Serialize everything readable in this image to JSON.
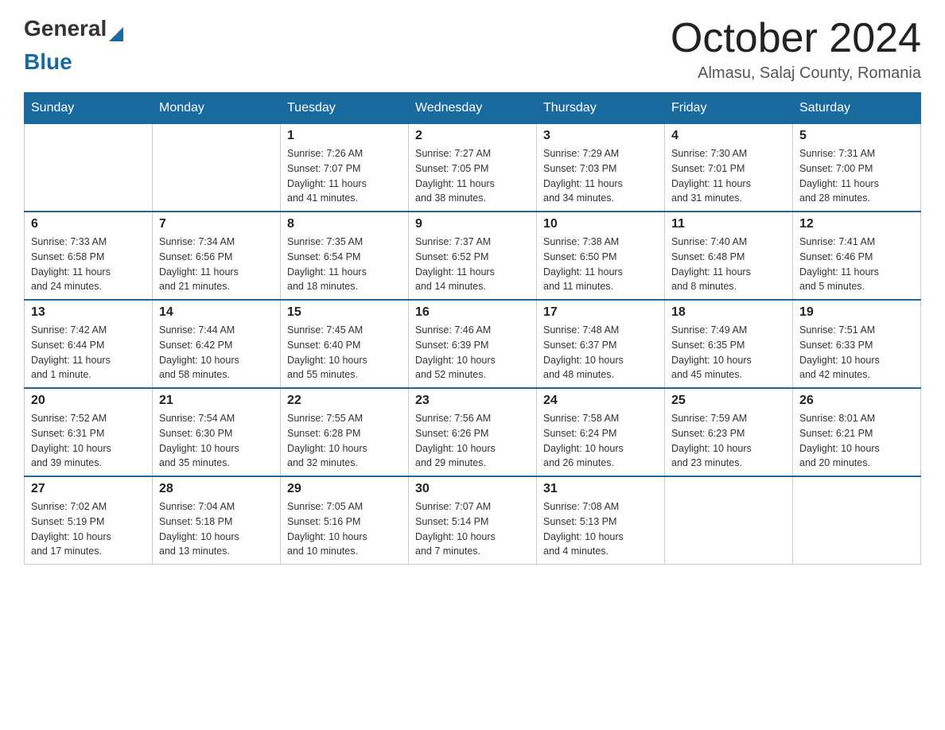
{
  "logo": {
    "general": "General",
    "blue": "Blue"
  },
  "title": "October 2024",
  "location": "Almasu, Salaj County, Romania",
  "weekdays": [
    "Sunday",
    "Monday",
    "Tuesday",
    "Wednesday",
    "Thursday",
    "Friday",
    "Saturday"
  ],
  "weeks": [
    [
      {
        "day": "",
        "details": ""
      },
      {
        "day": "",
        "details": ""
      },
      {
        "day": "1",
        "details": "Sunrise: 7:26 AM\nSunset: 7:07 PM\nDaylight: 11 hours\nand 41 minutes."
      },
      {
        "day": "2",
        "details": "Sunrise: 7:27 AM\nSunset: 7:05 PM\nDaylight: 11 hours\nand 38 minutes."
      },
      {
        "day": "3",
        "details": "Sunrise: 7:29 AM\nSunset: 7:03 PM\nDaylight: 11 hours\nand 34 minutes."
      },
      {
        "day": "4",
        "details": "Sunrise: 7:30 AM\nSunset: 7:01 PM\nDaylight: 11 hours\nand 31 minutes."
      },
      {
        "day": "5",
        "details": "Sunrise: 7:31 AM\nSunset: 7:00 PM\nDaylight: 11 hours\nand 28 minutes."
      }
    ],
    [
      {
        "day": "6",
        "details": "Sunrise: 7:33 AM\nSunset: 6:58 PM\nDaylight: 11 hours\nand 24 minutes."
      },
      {
        "day": "7",
        "details": "Sunrise: 7:34 AM\nSunset: 6:56 PM\nDaylight: 11 hours\nand 21 minutes."
      },
      {
        "day": "8",
        "details": "Sunrise: 7:35 AM\nSunset: 6:54 PM\nDaylight: 11 hours\nand 18 minutes."
      },
      {
        "day": "9",
        "details": "Sunrise: 7:37 AM\nSunset: 6:52 PM\nDaylight: 11 hours\nand 14 minutes."
      },
      {
        "day": "10",
        "details": "Sunrise: 7:38 AM\nSunset: 6:50 PM\nDaylight: 11 hours\nand 11 minutes."
      },
      {
        "day": "11",
        "details": "Sunrise: 7:40 AM\nSunset: 6:48 PM\nDaylight: 11 hours\nand 8 minutes."
      },
      {
        "day": "12",
        "details": "Sunrise: 7:41 AM\nSunset: 6:46 PM\nDaylight: 11 hours\nand 5 minutes."
      }
    ],
    [
      {
        "day": "13",
        "details": "Sunrise: 7:42 AM\nSunset: 6:44 PM\nDaylight: 11 hours\nand 1 minute."
      },
      {
        "day": "14",
        "details": "Sunrise: 7:44 AM\nSunset: 6:42 PM\nDaylight: 10 hours\nand 58 minutes."
      },
      {
        "day": "15",
        "details": "Sunrise: 7:45 AM\nSunset: 6:40 PM\nDaylight: 10 hours\nand 55 minutes."
      },
      {
        "day": "16",
        "details": "Sunrise: 7:46 AM\nSunset: 6:39 PM\nDaylight: 10 hours\nand 52 minutes."
      },
      {
        "day": "17",
        "details": "Sunrise: 7:48 AM\nSunset: 6:37 PM\nDaylight: 10 hours\nand 48 minutes."
      },
      {
        "day": "18",
        "details": "Sunrise: 7:49 AM\nSunset: 6:35 PM\nDaylight: 10 hours\nand 45 minutes."
      },
      {
        "day": "19",
        "details": "Sunrise: 7:51 AM\nSunset: 6:33 PM\nDaylight: 10 hours\nand 42 minutes."
      }
    ],
    [
      {
        "day": "20",
        "details": "Sunrise: 7:52 AM\nSunset: 6:31 PM\nDaylight: 10 hours\nand 39 minutes."
      },
      {
        "day": "21",
        "details": "Sunrise: 7:54 AM\nSunset: 6:30 PM\nDaylight: 10 hours\nand 35 minutes."
      },
      {
        "day": "22",
        "details": "Sunrise: 7:55 AM\nSunset: 6:28 PM\nDaylight: 10 hours\nand 32 minutes."
      },
      {
        "day": "23",
        "details": "Sunrise: 7:56 AM\nSunset: 6:26 PM\nDaylight: 10 hours\nand 29 minutes."
      },
      {
        "day": "24",
        "details": "Sunrise: 7:58 AM\nSunset: 6:24 PM\nDaylight: 10 hours\nand 26 minutes."
      },
      {
        "day": "25",
        "details": "Sunrise: 7:59 AM\nSunset: 6:23 PM\nDaylight: 10 hours\nand 23 minutes."
      },
      {
        "day": "26",
        "details": "Sunrise: 8:01 AM\nSunset: 6:21 PM\nDaylight: 10 hours\nand 20 minutes."
      }
    ],
    [
      {
        "day": "27",
        "details": "Sunrise: 7:02 AM\nSunset: 5:19 PM\nDaylight: 10 hours\nand 17 minutes."
      },
      {
        "day": "28",
        "details": "Sunrise: 7:04 AM\nSunset: 5:18 PM\nDaylight: 10 hours\nand 13 minutes."
      },
      {
        "day": "29",
        "details": "Sunrise: 7:05 AM\nSunset: 5:16 PM\nDaylight: 10 hours\nand 10 minutes."
      },
      {
        "day": "30",
        "details": "Sunrise: 7:07 AM\nSunset: 5:14 PM\nDaylight: 10 hours\nand 7 minutes."
      },
      {
        "day": "31",
        "details": "Sunrise: 7:08 AM\nSunset: 5:13 PM\nDaylight: 10 hours\nand 4 minutes."
      },
      {
        "day": "",
        "details": ""
      },
      {
        "day": "",
        "details": ""
      }
    ]
  ]
}
